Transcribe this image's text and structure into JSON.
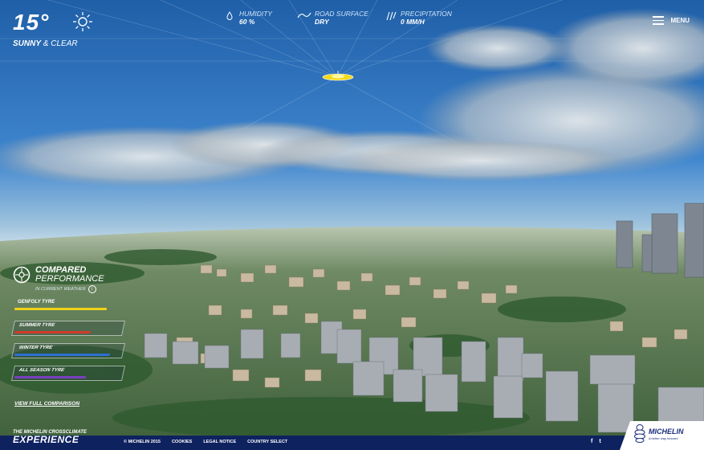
{
  "weather": {
    "temperature": "15°",
    "condition_main": "SUNNY",
    "condition_sep": "&",
    "condition_rest": "CLEAR",
    "humidity_label": "HUMIDITY",
    "humidity_value": "60 %",
    "road_label": "ROAD SURFACE",
    "road_value": "DRY",
    "precip_label": "PRECIPITATION",
    "precip_value": "0 MM/H"
  },
  "header": {
    "menu_label": "MENU"
  },
  "panel": {
    "title_1": "COMPARED",
    "title_2": "PERFORMANCE",
    "subtitle": "IN CURRENT WEATHER",
    "tyres": [
      {
        "label": "GENFOLY TYRE",
        "level": 0.85,
        "color": "#f0d21a"
      },
      {
        "label": "SUMMER TYRE",
        "level": 0.7,
        "color": "#d23a2a"
      },
      {
        "label": "WINTER TYRE",
        "level": 0.88,
        "color": "#2d6fd4"
      },
      {
        "label": "ALL SEASON TYRE",
        "level": 0.66,
        "color": "#7a3fbf"
      }
    ],
    "view_link": "VIEW FULL COMPARISON"
  },
  "footer": {
    "brand_line1": "THE MICHELIN CROSSCLIMATE",
    "brand_line2": "EXPERIENCE",
    "copyright": "© MICHELIN 2015",
    "links": [
      "COOKIES",
      "LEGAL NOTICE",
      "COUNTRY SELECT"
    ],
    "social": [
      "f",
      "t"
    ]
  },
  "logo": {
    "name": "MICHELIN",
    "tagline": "A better way forward"
  }
}
